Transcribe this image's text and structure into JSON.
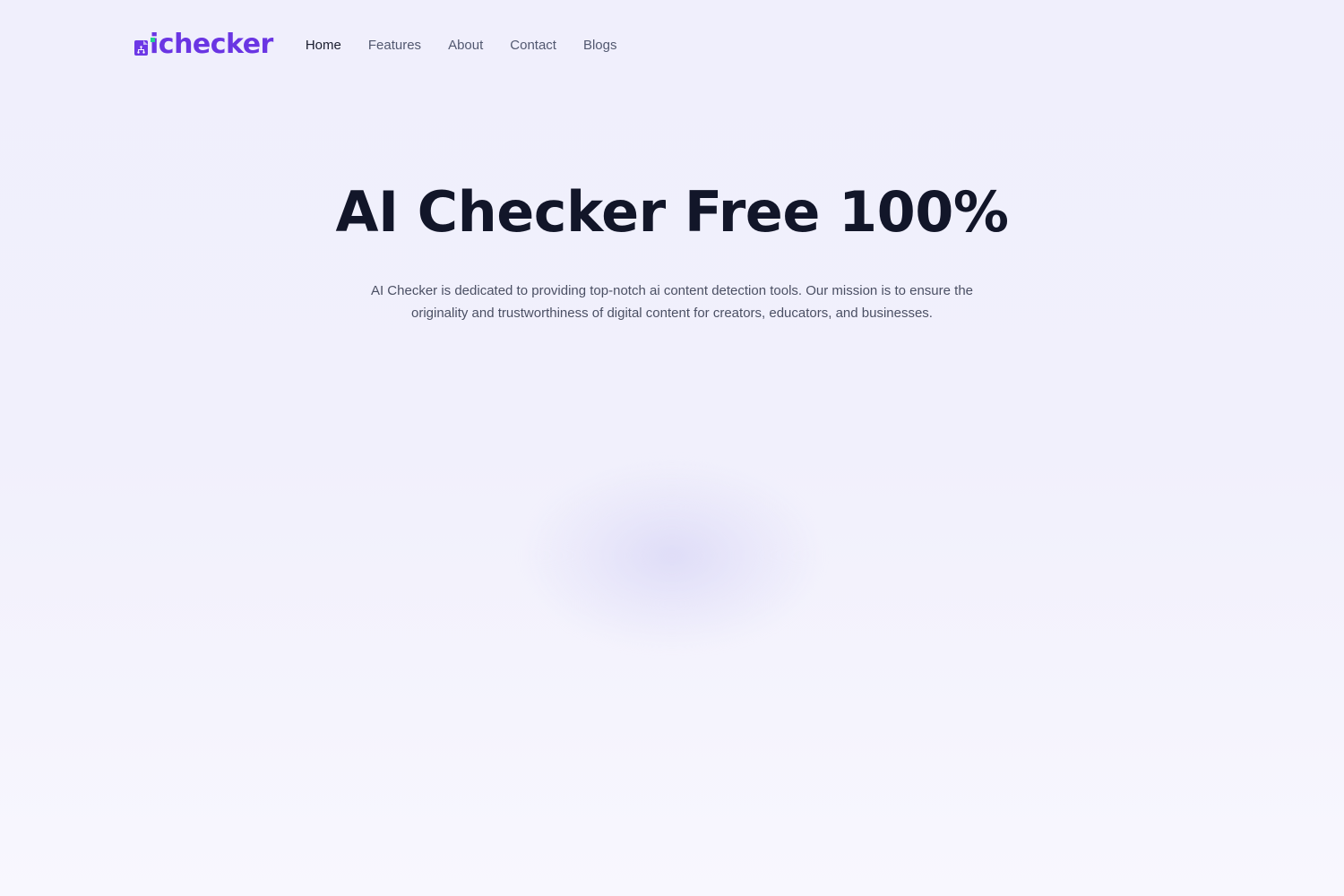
{
  "brand": {
    "name": "ichecker",
    "logo_icon": "document-network-icon",
    "primary_color": "#6a35e3",
    "accent_color": "#22d38f"
  },
  "nav": {
    "items": [
      {
        "label": "Home",
        "active": true
      },
      {
        "label": "Features",
        "active": false
      },
      {
        "label": "About",
        "active": false
      },
      {
        "label": "Contact",
        "active": false
      },
      {
        "label": "Blogs",
        "active": false
      }
    ]
  },
  "hero": {
    "title": "AI Checker Free 100%",
    "description": "AI Checker is dedicated to providing top-notch ai content detection tools. Our mission is to ensure the originality and trustworthiness of digital content for creators, educators, and businesses."
  }
}
